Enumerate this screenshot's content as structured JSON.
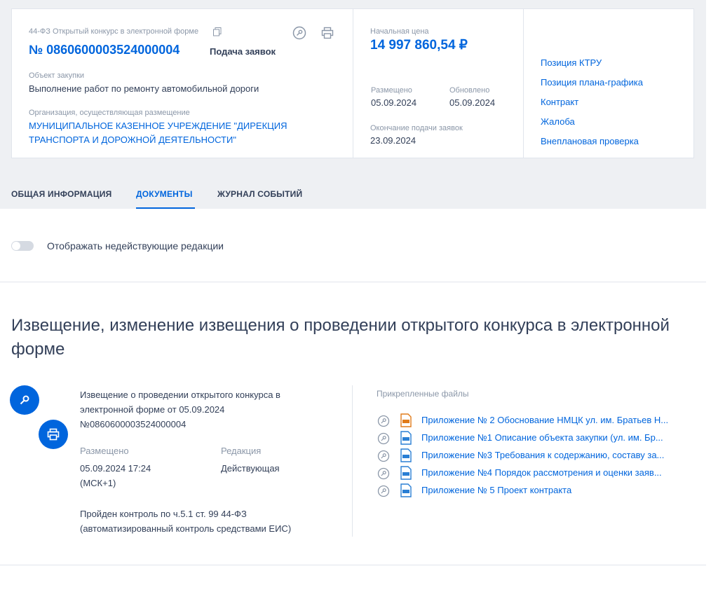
{
  "header": {
    "law_label": "44-ФЗ Открытый конкурс в электронной форме",
    "notice_number": "№ 0860600003524000004",
    "stage": "Подача заявок",
    "object_label": "Объект закупки",
    "object_value": "Выполнение работ по ремонту автомобильной дороги",
    "org_label": "Организация, осуществляющая размещение",
    "org_value": "МУНИЦИПАЛЬНОЕ КАЗЕННОЕ УЧРЕЖДЕНИЕ \"ДИРЕКЦИЯ ТРАНСПОРТА И ДОРОЖНОЙ ДЕЯТЕЛЬНОСТИ\"",
    "price_label": "Начальная цена",
    "price_value": "14 997 860,54 ₽",
    "posted_label": "Размещено",
    "posted_value": "05.09.2024",
    "updated_label": "Обновлено",
    "updated_value": "05.09.2024",
    "deadline_label": "Окончание подачи заявок",
    "deadline_value": "23.09.2024",
    "links": [
      "Позиция КТРУ",
      "Позиция плана-графика",
      "Контракт",
      "Жалоба",
      "Внеплановая проверка"
    ]
  },
  "tabs": [
    {
      "label": "ОБЩАЯ ИНФОРМАЦИЯ"
    },
    {
      "label": "ДОКУМЕНТЫ"
    },
    {
      "label": "ЖУРНАЛ СОБЫТИЙ"
    }
  ],
  "toggle_label": "Отображать недействующие редакции",
  "section_title": "Извещение, изменение извещения о проведении открытого конкурса в электронной форме",
  "document": {
    "title": "Извещение о проведении открытого конкурса в электронной форме от 05.09.2024 №0860600003524000004",
    "posted_label": "Размещено",
    "posted_value": "05.09.2024 17:24 (МСК+1)",
    "edition_label": "Редакция",
    "edition_value": "Действующая",
    "control_text": "Пройден контроль по ч.5.1 ст. 99 44-ФЗ (автоматизированный контроль средствами ЕИС)"
  },
  "attachments": {
    "label": "Прикрепленные файлы",
    "files": [
      {
        "name": "Приложение № 2 Обоснование НМЦК ул. им. Братьев Н...",
        "type": "xlsx-icon"
      },
      {
        "name": "Приложение №1 Описание объекта закупки (ул. им. Бр...",
        "type": "docx-icon"
      },
      {
        "name": "Приложение №3 Требования к содержанию, составу за...",
        "type": "docx-icon"
      },
      {
        "name": "Приложение №4 Порядок рассмотрения и оценки заяв...",
        "type": "docx-icon"
      },
      {
        "name": "Приложение № 5 Проект контракта",
        "type": "docx-icon"
      }
    ]
  },
  "colors": {
    "accent": "#0065dd",
    "text": "#334059",
    "muted": "#8b97a8",
    "xlsx": "#e07b1a",
    "docx": "#2a7fd4"
  }
}
